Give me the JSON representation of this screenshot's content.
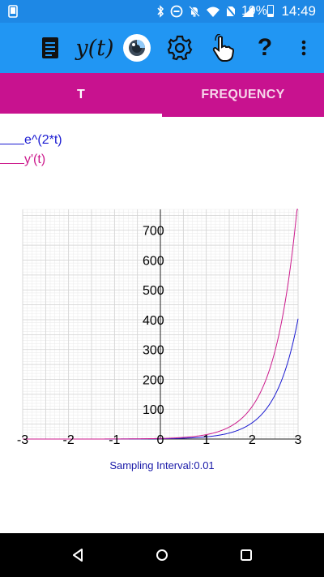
{
  "status_bar": {
    "battery": "19%",
    "time": "14:49",
    "icons": [
      "bluetooth-icon",
      "dnd-icon",
      "notifications-off-icon",
      "wifi-icon",
      "no-sim-icon",
      "signal-icon",
      "battery-icon"
    ]
  },
  "toolbar": {
    "items": [
      "notes-icon",
      "yt-button",
      "view-icon",
      "gear-icon",
      "touch-icon",
      "help-button",
      "more-icon"
    ],
    "yt_label": "y(t)",
    "help_label": "?"
  },
  "tabs": [
    {
      "label": "T",
      "active": true
    },
    {
      "label": "FREQUENCY",
      "active": false
    }
  ],
  "legend": [
    {
      "label": "e^(2*t)",
      "color": "#1a1ad1"
    },
    {
      "label": "y'(t)",
      "color": "#cc1a8c"
    }
  ],
  "chart_data": {
    "type": "line",
    "x_ticks": [
      "-3",
      "-2",
      "-1",
      "0",
      "1",
      "2",
      "3"
    ],
    "y_ticks": [
      "100",
      "200",
      "300",
      "400",
      "500",
      "600",
      "700"
    ],
    "xlim": [
      -3,
      3
    ],
    "ylim": [
      0,
      770
    ],
    "grid": true,
    "series": [
      {
        "name": "e^(2*t)",
        "color": "#1a1ad1",
        "formula": "exp(2t)"
      },
      {
        "name": "y'(t)",
        "color": "#cc1a8c",
        "formula": "2*exp(2t)"
      }
    ]
  },
  "sampling_text": "Sampling Interval:0.01",
  "colors": {
    "status_bar": "#1e88e5",
    "toolbar": "#2196f3",
    "tabs": "#c8128f"
  }
}
